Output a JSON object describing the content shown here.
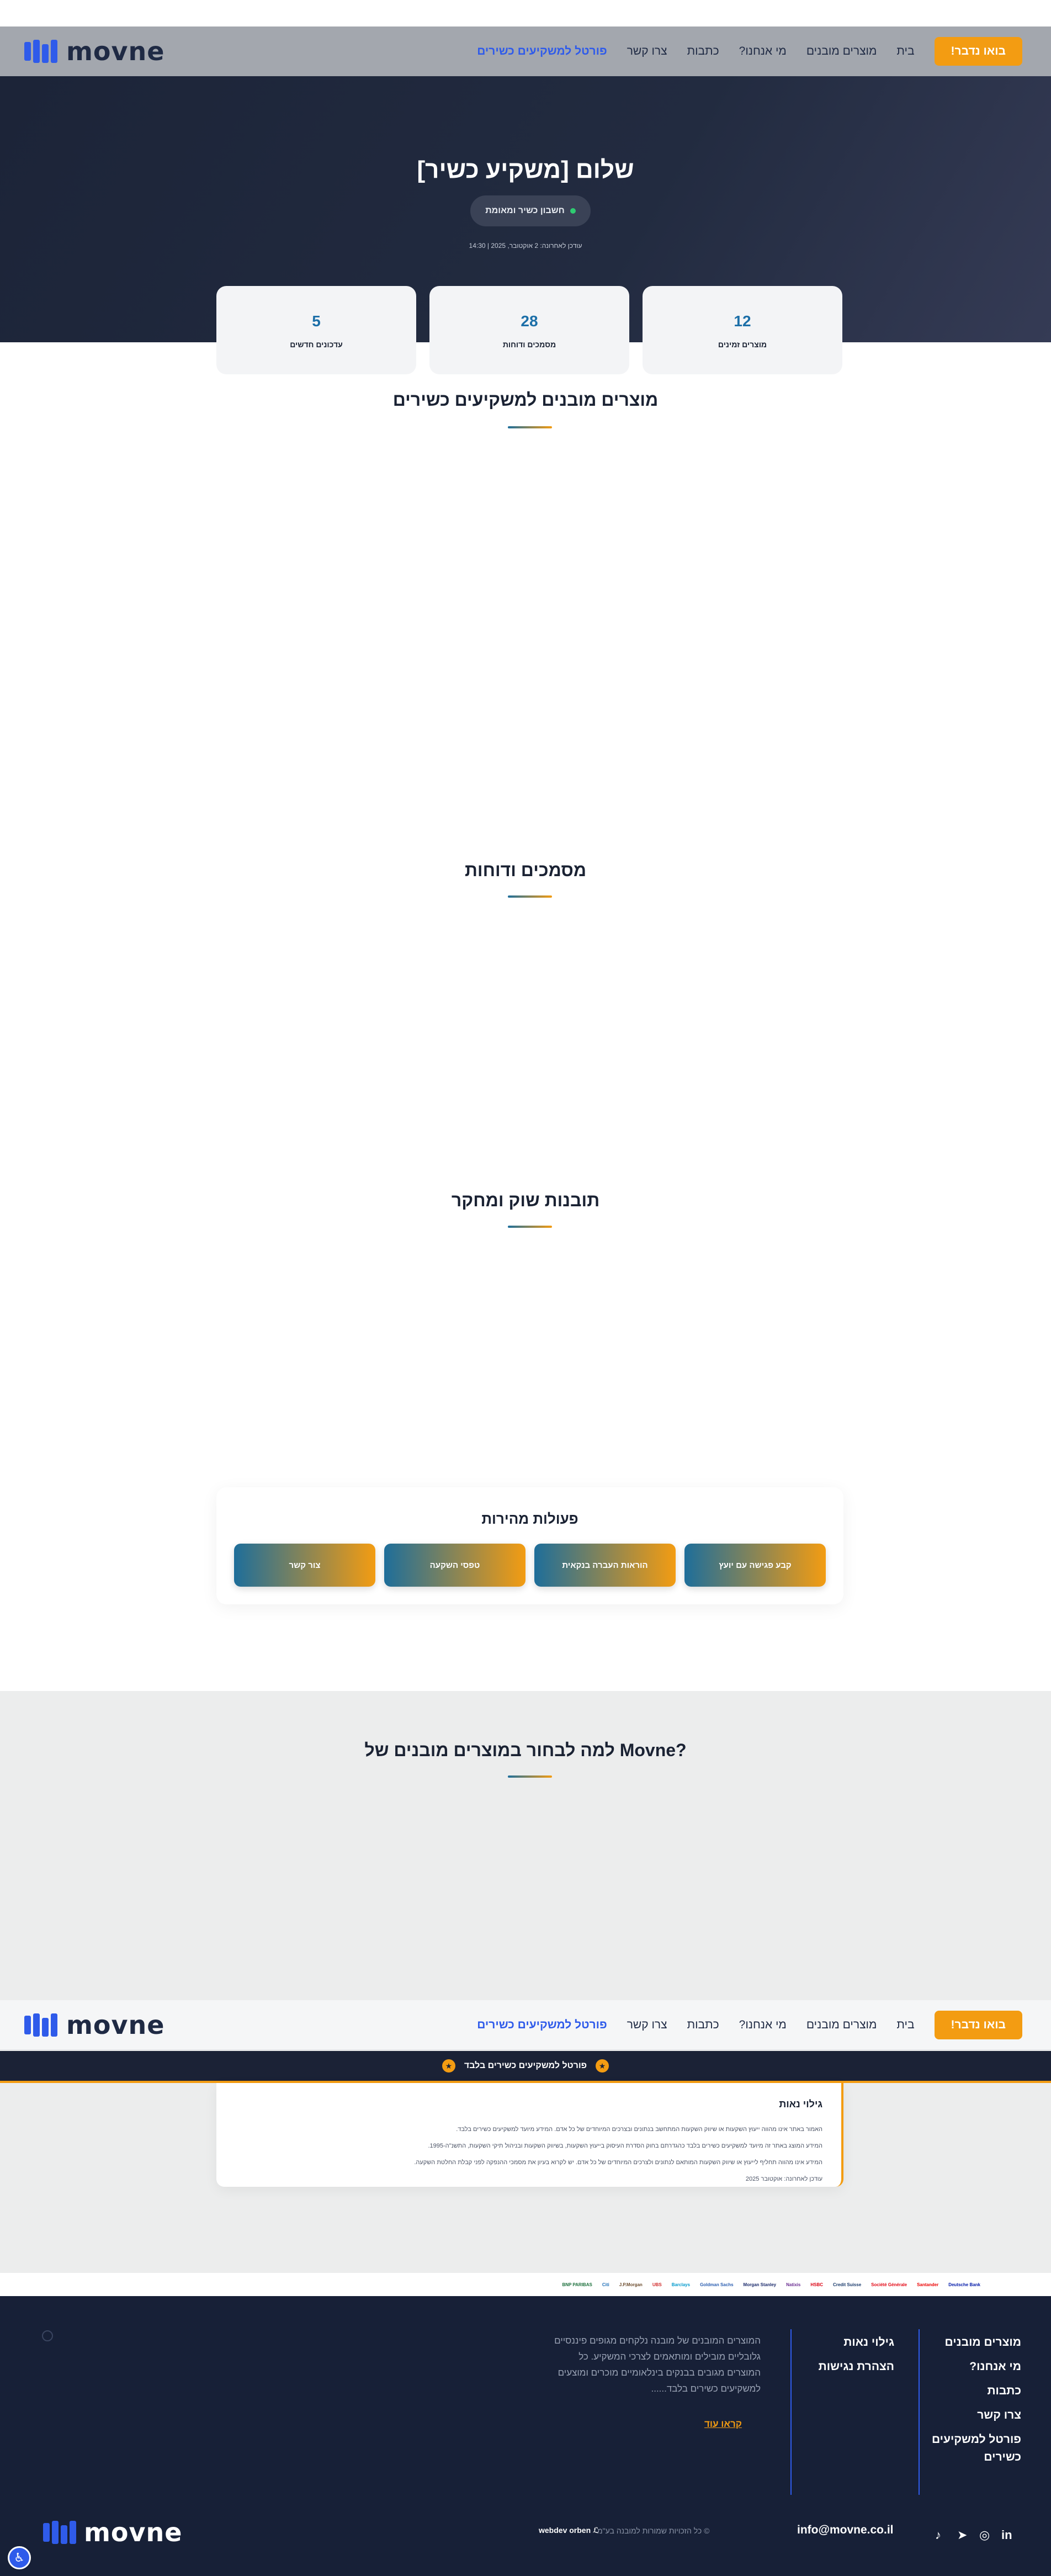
{
  "brand": {
    "name": "movne",
    "accent": "#f39c12",
    "primary": "#2f5bea",
    "dark": "#1c2438"
  },
  "nav": {
    "cta": "בואו נדבר!",
    "items": [
      "בית",
      "מוצרים מובנים",
      "מי אנחנו?",
      "כתבות",
      "צרו קשר"
    ],
    "active_item": "פורטל למשקיעים כשירים"
  },
  "hero": {
    "title": "שלום [משקיע כשיר]",
    "badge": "חשבון כשיר ומאומת",
    "badge_icon": "check-dot-icon",
    "updated": "עודכן לאחרונה: 2 אוקטובר, 2025 | 14:30",
    "stats": [
      {
        "value": "12",
        "label": "מוצרים זמינים"
      },
      {
        "value": "28",
        "label": "מסמכים ודוחות"
      },
      {
        "value": "5",
        "label": "עדכונים חדשים"
      }
    ]
  },
  "sections": {
    "products_title": "מוצרים מובנים למשקיעים כשירים",
    "docs_title": "מסמכים ודוחות",
    "insights_title": "תובנות שוק ומחקר",
    "why_title": "למה לבחור במוצרים מובנים של Movne?"
  },
  "quick_actions": {
    "title": "פעולות מהירות",
    "buttons": [
      "קבע פגישה עם יועץ",
      "הוראות העברה בנקאית",
      "טפסי השקעה",
      "צור קשר"
    ]
  },
  "portal_strip": {
    "label": "פורטל למשקיעים כשירים בלבד",
    "icon": "star-icon"
  },
  "disclaimer": {
    "title": "גילוי נאות",
    "lines": [
      "האמור באתר אינו מהווה ייעוץ השקעות או שיווק השקעות המתחשב בנתונים ובצרכים המיוחדים של כל אדם. המידע מיועד למשקיעים כשירים בלבד.",
      "המידע המוצג באתר זה מיועד למשקיעים כשירים בלבד כהגדרתם בחוק הסדרת העיסוק בייעוץ השקעות, בשיווק השקעות ובניהול תיקי השקעות, התשנ\"ה-1995.",
      "המידע אינו מהווה תחליף לייעוץ או שיווק השקעות המותאם לנתונים ולצרכים המיוחדים של כל אדם. יש לקרוא בעיון את מסמכי ההנפקה לפני קבלת החלטת השקעה.",
      "עודכן לאחרונה: אוקטובר 2025"
    ]
  },
  "partners": [
    "BNP PARIBAS",
    "Citi",
    "J.P.Morgan",
    "UBS",
    "Barclays",
    "Goldman Sachs",
    "Morgan Stanley",
    "Natixis",
    "HSBC",
    "Credit Suisse",
    "Société Générale",
    "Santander",
    "Deutsche Bank"
  ],
  "footer": {
    "col_main": [
      "מוצרים מובנים",
      "מי אנחנו?",
      "כתבות",
      "צרו קשר",
      "פורטל למשקיעים",
      "כשירים"
    ],
    "col_legal": [
      "גילוי נאות",
      "הצהרת נגישות"
    ],
    "about": "המוצרים המובנים של מובנה נלקחים מגופים פיננסיים גלובליים מובילים ומותאמים לצרכי המשקיע. כל המוצרים מגובים בבנקים בינלאומיים מוכרים ומוצעים למשקיעים כשירים בלבד......",
    "read_more": "קראו עוד",
    "email": "info@movne.co.il",
    "copyright": "© כל הזכויות שמורות למובנה בע\"מ",
    "credit": "webdev orben"
  }
}
